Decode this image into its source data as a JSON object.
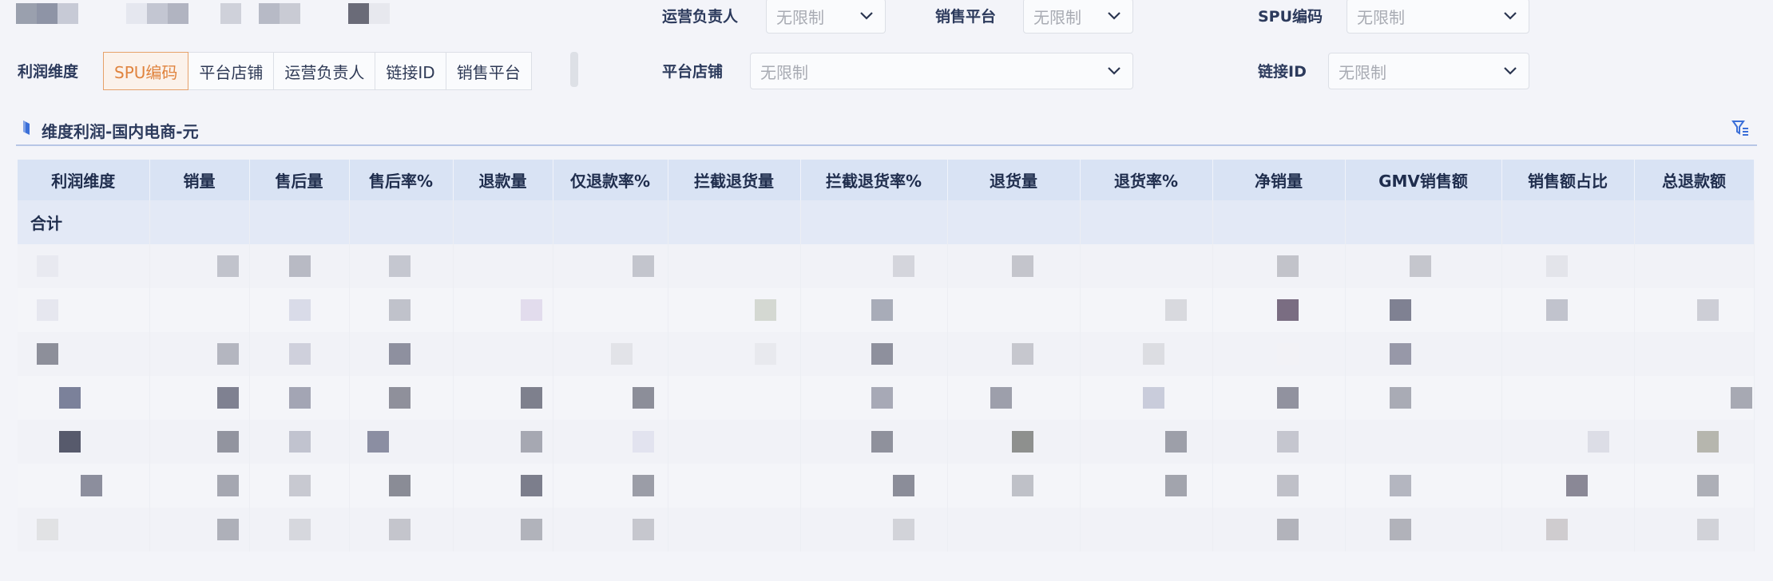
{
  "filters": {
    "operator": {
      "label": "运营负责人",
      "placeholder": "无限制"
    },
    "platform": {
      "label": "销售平台",
      "placeholder": "无限制"
    },
    "spu": {
      "label": "SPU编码",
      "placeholder": "无限制"
    },
    "store": {
      "label": "平台店铺",
      "placeholder": "无限制"
    },
    "link_id": {
      "label": "链接ID",
      "placeholder": "无限制"
    }
  },
  "dimension": {
    "label": "利润维度",
    "options": [
      "SPU编码",
      "平台店铺",
      "运营负责人",
      "链接ID",
      "销售平台"
    ],
    "selected": "SPU编码"
  },
  "section": {
    "title": "维度利润-国内电商-元"
  },
  "table": {
    "columns": [
      "利润维度",
      "销量",
      "售后量",
      "售后率%",
      "退款量",
      "仅退款率%",
      "拦截退货量",
      "拦截退货率%",
      "退货量",
      "退货率%",
      "净销量",
      "GMV销售额",
      "销售额占比",
      "总退款额"
    ],
    "total_label": "合计"
  },
  "colors": {
    "accent": "#e0843f",
    "header_bg": "#d9e3f4",
    "link_blue": "#3b6fd8"
  },
  "icons": {
    "section": "bookmark-icon",
    "filter_settings": "filter-settings-icon",
    "dropdown": "chevron-down-icon"
  }
}
